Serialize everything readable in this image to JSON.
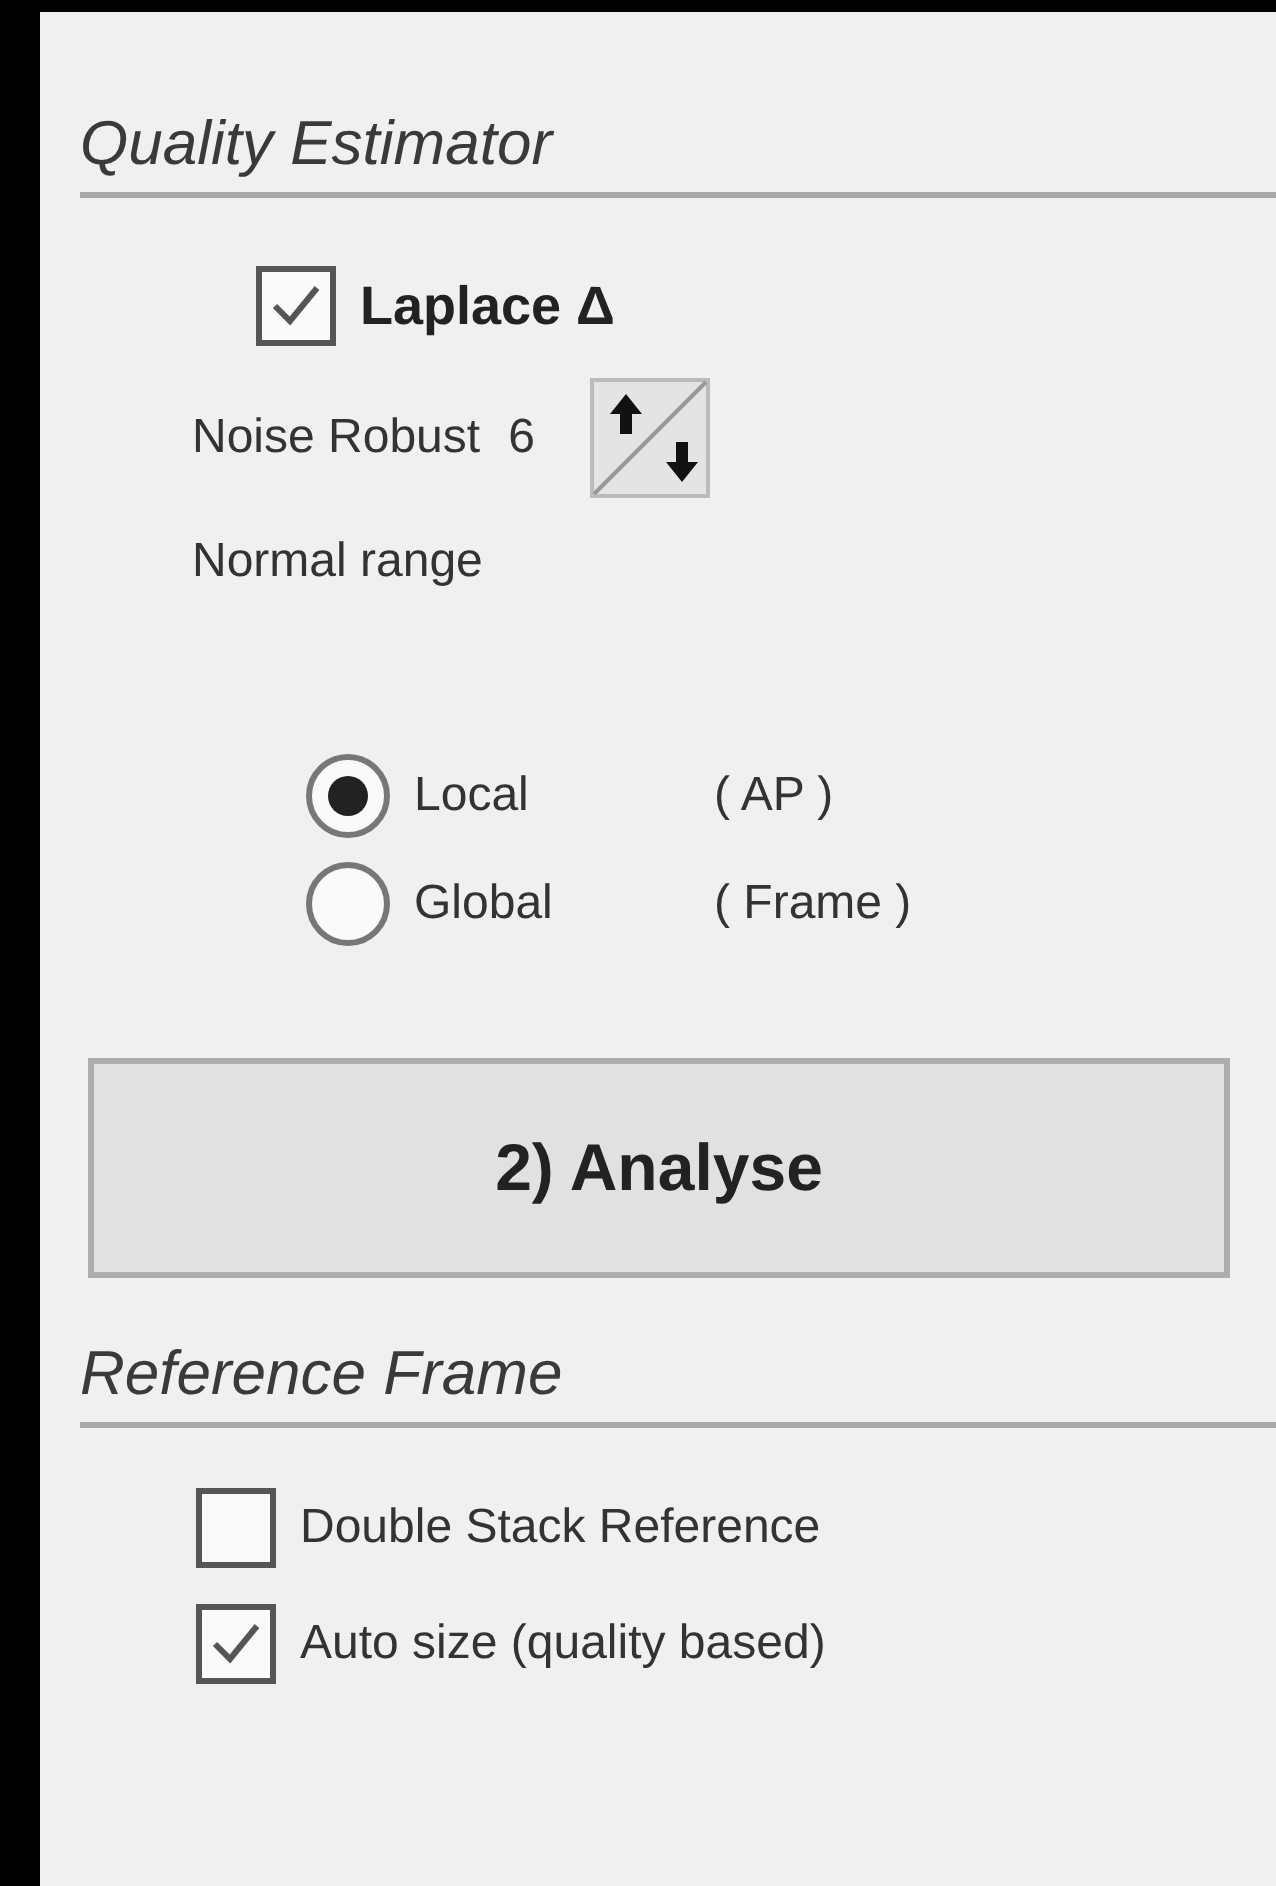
{
  "quality_estimator": {
    "title": "Quality Estimator",
    "laplace": {
      "label": "Laplace Δ",
      "checked": true
    },
    "noise_robust": {
      "label": "Noise Robust",
      "value": "6"
    },
    "range_label": "Normal range",
    "scope_options": [
      {
        "label": "Local",
        "detail": "( AP )",
        "selected": true
      },
      {
        "label": "Global",
        "detail": "( Frame )",
        "selected": false
      }
    ]
  },
  "analyse_button": "2) Analyse",
  "reference_frame": {
    "title": "Reference Frame",
    "options": [
      {
        "label": "Double Stack Reference",
        "checked": false
      },
      {
        "label": "Auto size (quality based)",
        "checked": true
      }
    ]
  }
}
